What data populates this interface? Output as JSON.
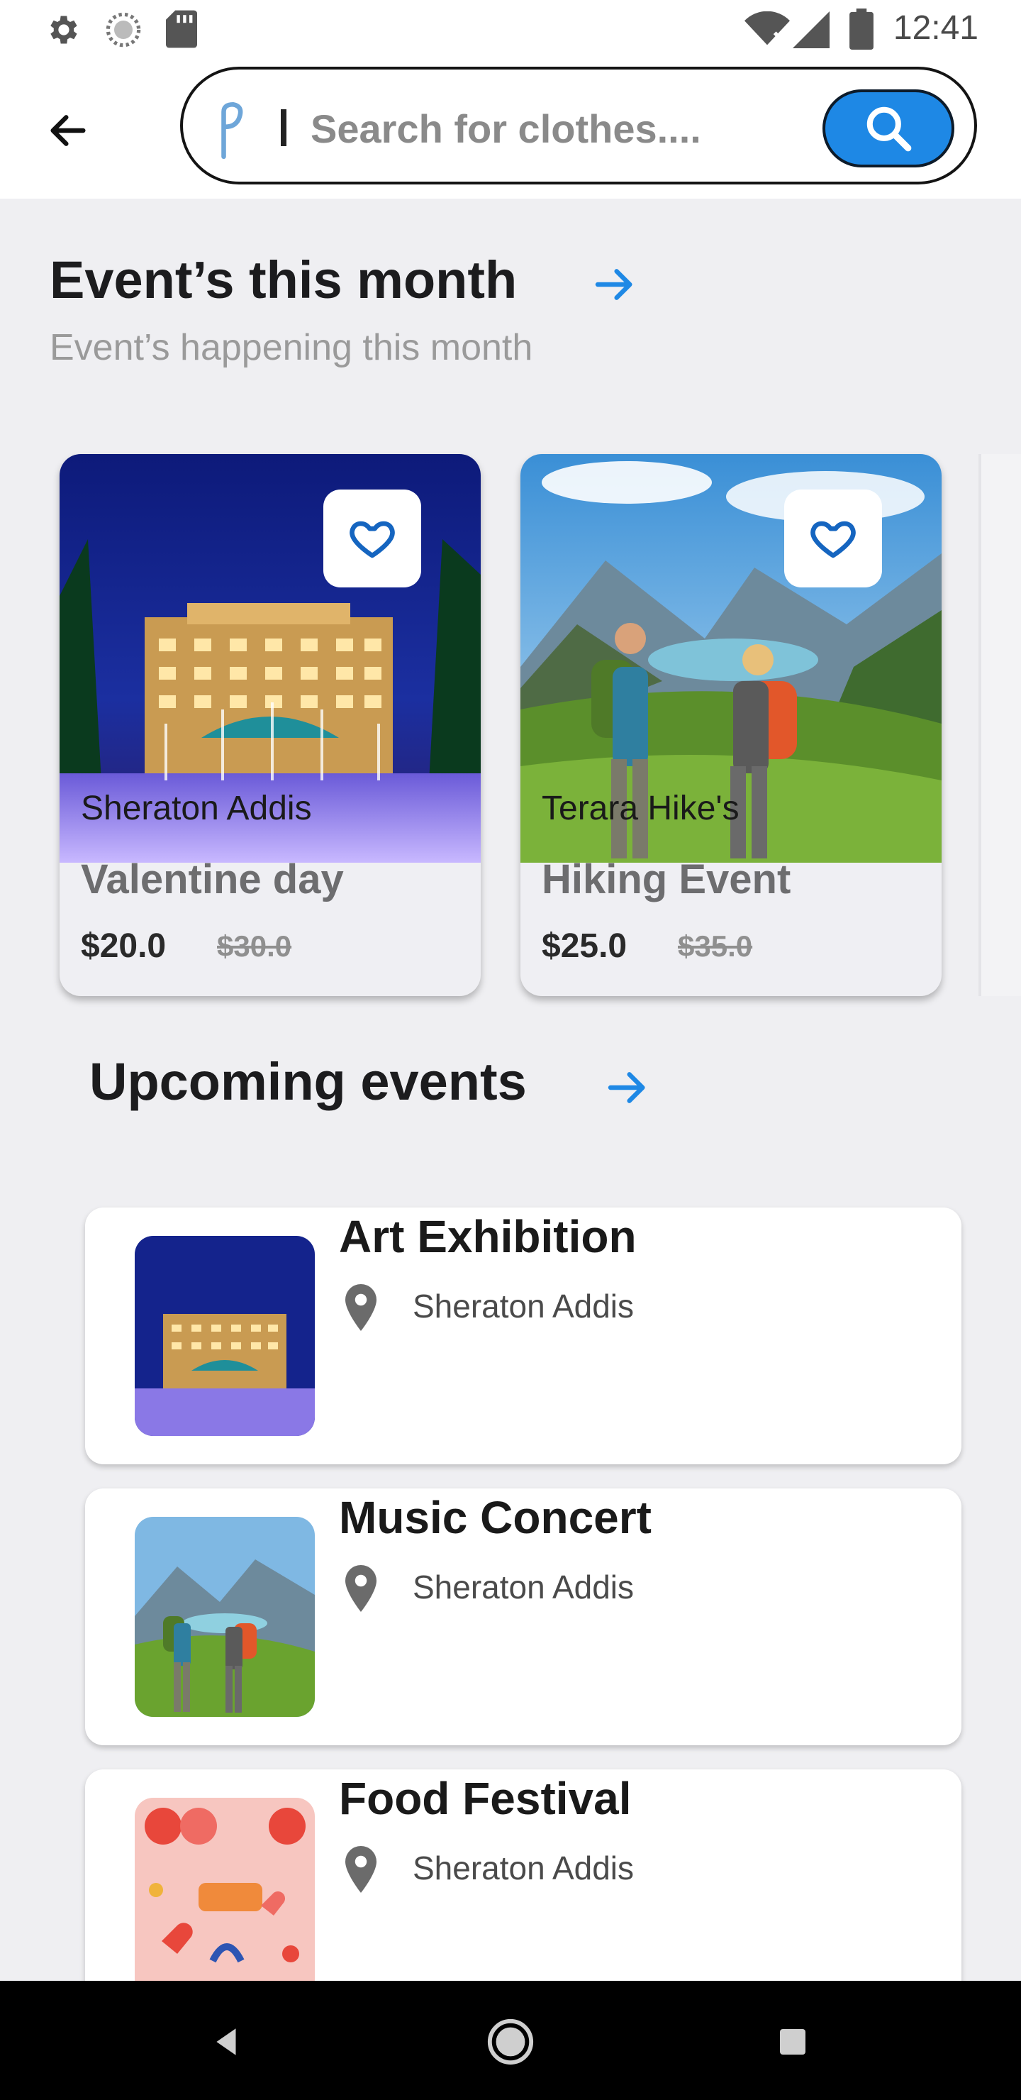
{
  "status_bar": {
    "time": "12:41",
    "icons": [
      "gear-icon",
      "sync-icon",
      "sd-card-icon",
      "wifi-icon",
      "signal-icon",
      "battery-icon"
    ]
  },
  "header": {
    "search_placeholder": "Search for clothes....",
    "accent": "#1e88e5"
  },
  "month_section": {
    "title": "Event’s this month",
    "subtitle": "Event’s happening this month",
    "cards": [
      {
        "venue": "Sheraton Addis",
        "name": "Valentine day",
        "price": "$20.0",
        "old_price": "$30.0"
      },
      {
        "venue": "Terara Hike's",
        "name": "Hiking Event",
        "price": "$25.0",
        "old_price": "$35.0"
      }
    ]
  },
  "upcoming_section": {
    "title": "Upcoming events",
    "items": [
      {
        "title": "Art Exhibition",
        "venue": "Sheraton Addis"
      },
      {
        "title": "Music Concert",
        "venue": "Sheraton Addis"
      },
      {
        "title": "Food Festival",
        "venue": "Sheraton Addis"
      }
    ]
  },
  "nav": {
    "icons": [
      "back-triangle-icon",
      "home-circle-icon",
      "recents-square-icon"
    ]
  }
}
